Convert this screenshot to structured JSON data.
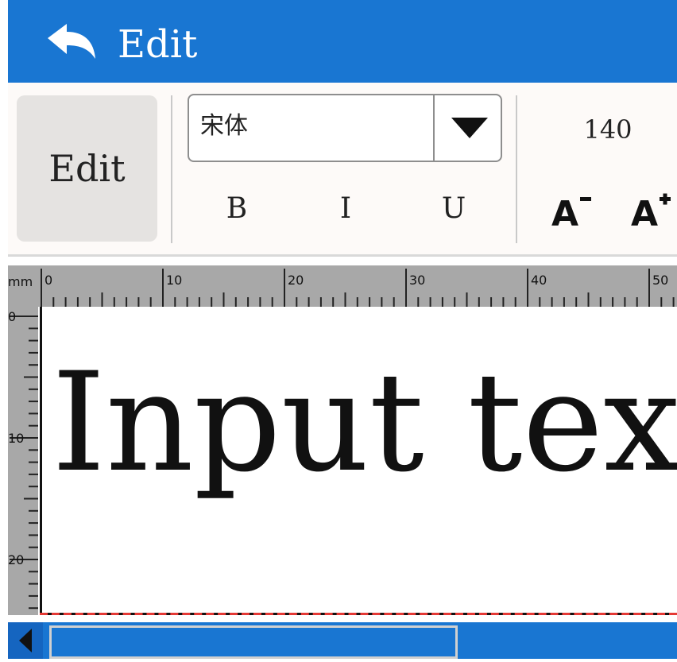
{
  "header": {
    "title": "Edit",
    "back_icon": "back-arrow-icon",
    "background_color": "#1976d2"
  },
  "toolbar": {
    "mode_button_label": "Edit",
    "font_family_value": "宋体",
    "bold_label": "B",
    "italic_label": "I",
    "underline_label": "U",
    "font_size_value": "140",
    "decrease_icon": "decrease-font-size-icon",
    "increase_icon": "increase-font-size-icon"
  },
  "ruler": {
    "unit_label": "mm",
    "horizontal_labels": [
      "0",
      "10",
      "20",
      "30",
      "40",
      "50"
    ],
    "vertical_labels": [
      "0",
      "10",
      "20"
    ]
  },
  "canvas": {
    "text": "Input tex",
    "guide_color": "#e53935"
  },
  "scrollbar": {
    "left_arrow_icon": "scroll-left-icon"
  }
}
